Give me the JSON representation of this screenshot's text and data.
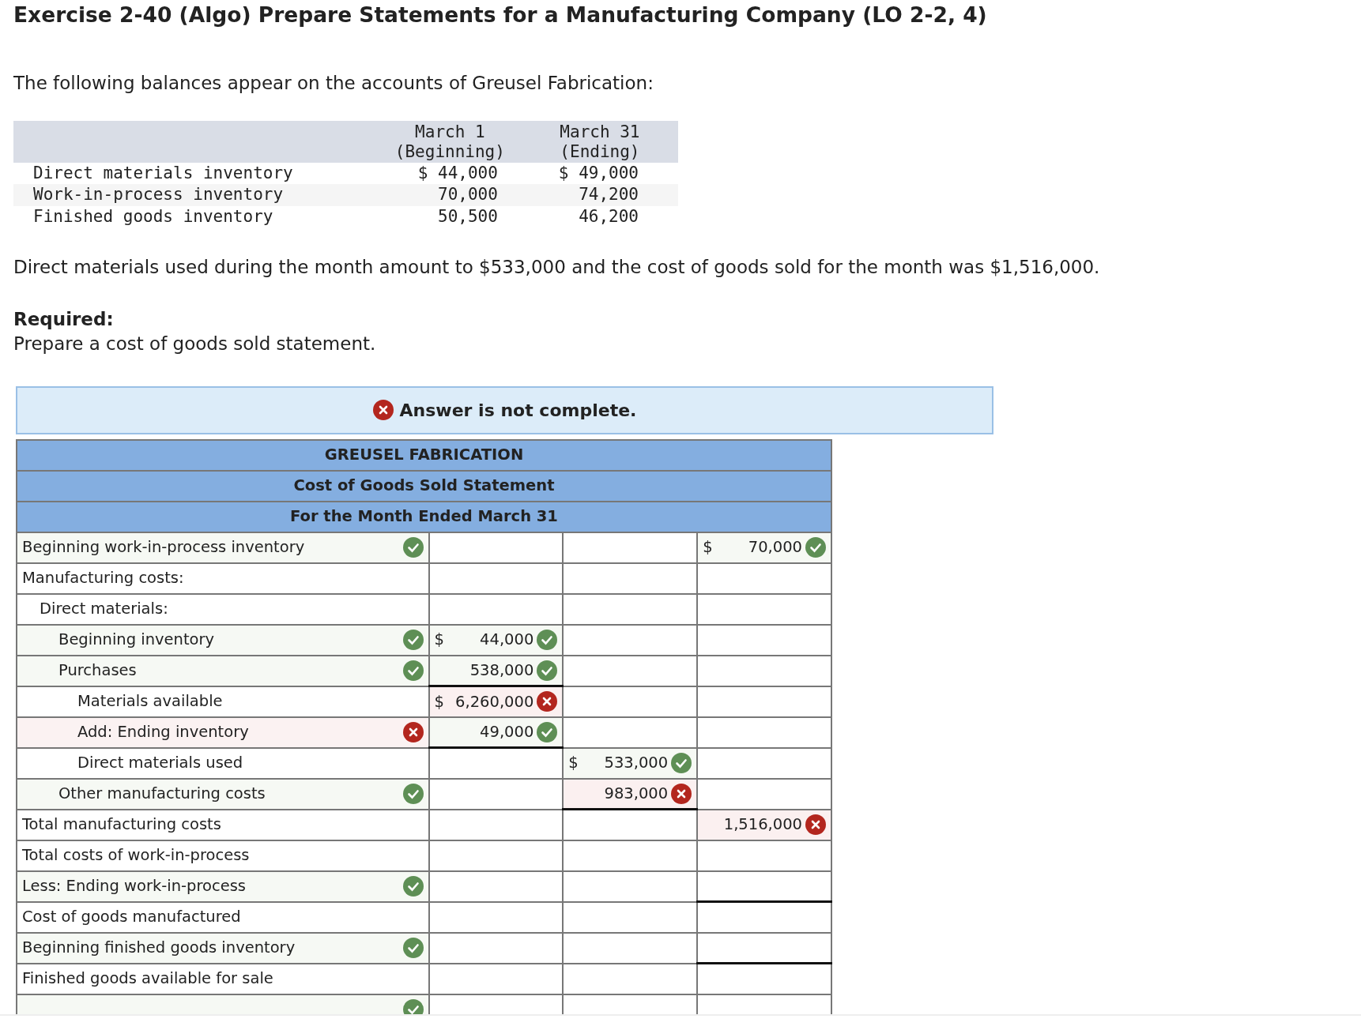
{
  "title": "Exercise 2-40 (Algo) Prepare Statements for a Manufacturing Company (LO 2-2, 4)",
  "intro": "The following balances appear on the accounts of Greusel Fabrication:",
  "balances": {
    "columns": [
      [
        "March 1",
        "(Beginning)"
      ],
      [
        "March 31",
        "(Ending)"
      ]
    ],
    "rows": [
      {
        "name": "Direct materials inventory",
        "values": [
          "$ 44,000",
          "$ 49,000"
        ]
      },
      {
        "name": "Work-in-process inventory",
        "values": [
          "70,000",
          "74,200"
        ]
      },
      {
        "name": "Finished goods inventory",
        "values": [
          "50,500",
          "46,200"
        ]
      }
    ]
  },
  "note": "Direct materials used during the month amount to $533,000 and the cost of goods sold for the month was $1,516,000.",
  "required_label": "Required:",
  "required_text": "Prepare a cost of goods sold statement.",
  "banner": {
    "text": "Answer is not complete.",
    "complete": false
  },
  "statement": {
    "headings": [
      "GREUSEL FABRICATION",
      "Cost of Goods Sold Statement",
      "For the Month Ended March 31"
    ],
    "rows": [
      {
        "label": "Beginning work-in-process inventory",
        "kind": "main",
        "correct": true,
        "cells": [
          null,
          null,
          {
            "dollar": "$",
            "value": "70,000",
            "correct": true
          }
        ]
      },
      {
        "label": "Manufacturing costs:",
        "kind": "main",
        "cells": [
          null,
          null,
          null
        ]
      },
      {
        "label": "Direct materials:",
        "kind": "group",
        "cells": [
          null,
          null,
          null
        ]
      },
      {
        "label": "Beginning inventory",
        "kind": "item",
        "correct": true,
        "cells": [
          {
            "dollar": "$",
            "value": "44,000",
            "correct": true
          },
          null,
          null
        ]
      },
      {
        "label": "Purchases",
        "kind": "item",
        "correct": true,
        "cells": [
          {
            "value": "538,000",
            "correct": true,
            "underlined": true
          },
          null,
          null
        ]
      },
      {
        "label": "Materials available",
        "kind": "calc",
        "cells": [
          {
            "dollar": "$",
            "value": "6,260,000",
            "correct": false
          },
          null,
          null
        ]
      },
      {
        "label": "Add: Ending inventory",
        "kind": "calc",
        "correct": false,
        "cells": [
          {
            "value": "49,000",
            "correct": true,
            "underlined": true
          },
          null,
          null
        ]
      },
      {
        "label": "Direct materials used",
        "kind": "calc",
        "cells": [
          null,
          {
            "dollar": "$",
            "value": "533,000",
            "correct": true
          },
          null
        ]
      },
      {
        "label": "Other manufacturing costs",
        "kind": "item",
        "correct": true,
        "cells": [
          null,
          {
            "value": "983,000",
            "correct": false,
            "underlined": true
          },
          null
        ]
      },
      {
        "label": "Total manufacturing costs",
        "kind": "main",
        "cells": [
          null,
          null,
          {
            "value": "1,516,000",
            "correct": false
          }
        ]
      },
      {
        "label": "Total costs of work-in-process",
        "kind": "main",
        "cells": [
          null,
          null,
          null
        ]
      },
      {
        "label": "Less: Ending work-in-process",
        "kind": "main",
        "correct": true,
        "cells": [
          null,
          null,
          {
            "underlined": true
          }
        ]
      },
      {
        "label": "Cost of goods manufactured",
        "kind": "main",
        "cells": [
          null,
          null,
          null
        ]
      },
      {
        "label": "Beginning finished goods inventory",
        "kind": "main",
        "correct": true,
        "cells": [
          null,
          null,
          {
            "underlined": true
          }
        ]
      },
      {
        "label": "Finished goods available for sale",
        "kind": "main",
        "cells": [
          null,
          null,
          null
        ]
      },
      {
        "kind": "main",
        "correct": true,
        "cells": [
          null,
          null,
          null
        ]
      }
    ]
  }
}
